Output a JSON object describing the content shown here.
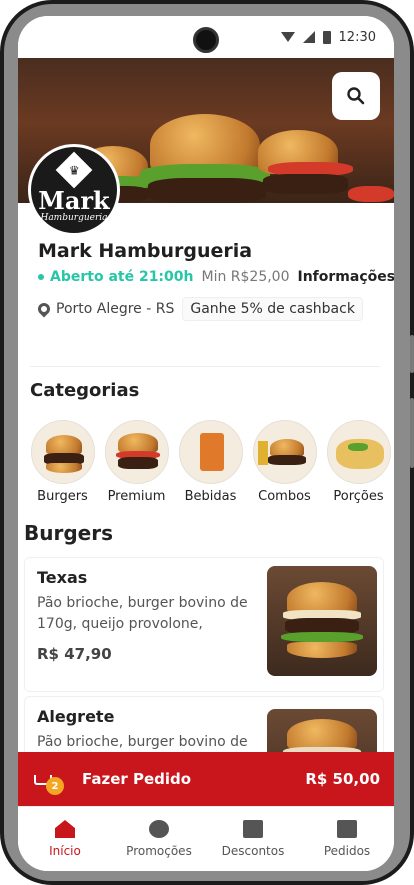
{
  "status_bar": {
    "time": "12:30"
  },
  "colors": {
    "accent": "#c8161c",
    "open_green": "#26c6a6",
    "badge": "#f5a623"
  },
  "header": {
    "search_icon": "search-icon"
  },
  "store": {
    "logo_text": "Mark",
    "logo_subtext": "Hamburgueria",
    "name": "Mark Hamburgueria",
    "status": "Aberto até 21:00h",
    "minimum": "Min R$25,00",
    "info_link": "Informações",
    "location": "Porto Alegre - RS",
    "cashback": "Ganhe 5% de cashback"
  },
  "categories": {
    "title": "Categorias",
    "items": [
      {
        "label": "Burgers"
      },
      {
        "label": "Premium"
      },
      {
        "label": "Bebidas"
      },
      {
        "label": "Combos"
      },
      {
        "label": "Porções"
      }
    ]
  },
  "section": {
    "title": "Burgers"
  },
  "products": [
    {
      "name": "Texas",
      "description": "Pão brioche, burger bovino de 170g, queijo provolone, molho...",
      "price": "R$ 47,90"
    },
    {
      "name": "Alegrete",
      "description": "Pão brioche, burger bovino de",
      "price": ""
    }
  ],
  "order_bar": {
    "badge_count": "2",
    "label": "Fazer Pedido",
    "total": "R$ 50,00"
  },
  "tabs": [
    {
      "label": "Início",
      "icon": "home-icon",
      "active": true
    },
    {
      "label": "Promoções",
      "icon": "percent-icon",
      "active": false
    },
    {
      "label": "Descontos",
      "icon": "ticket-icon",
      "active": false
    },
    {
      "label": "Pedidos",
      "icon": "clipboard-check-icon",
      "active": false
    }
  ]
}
